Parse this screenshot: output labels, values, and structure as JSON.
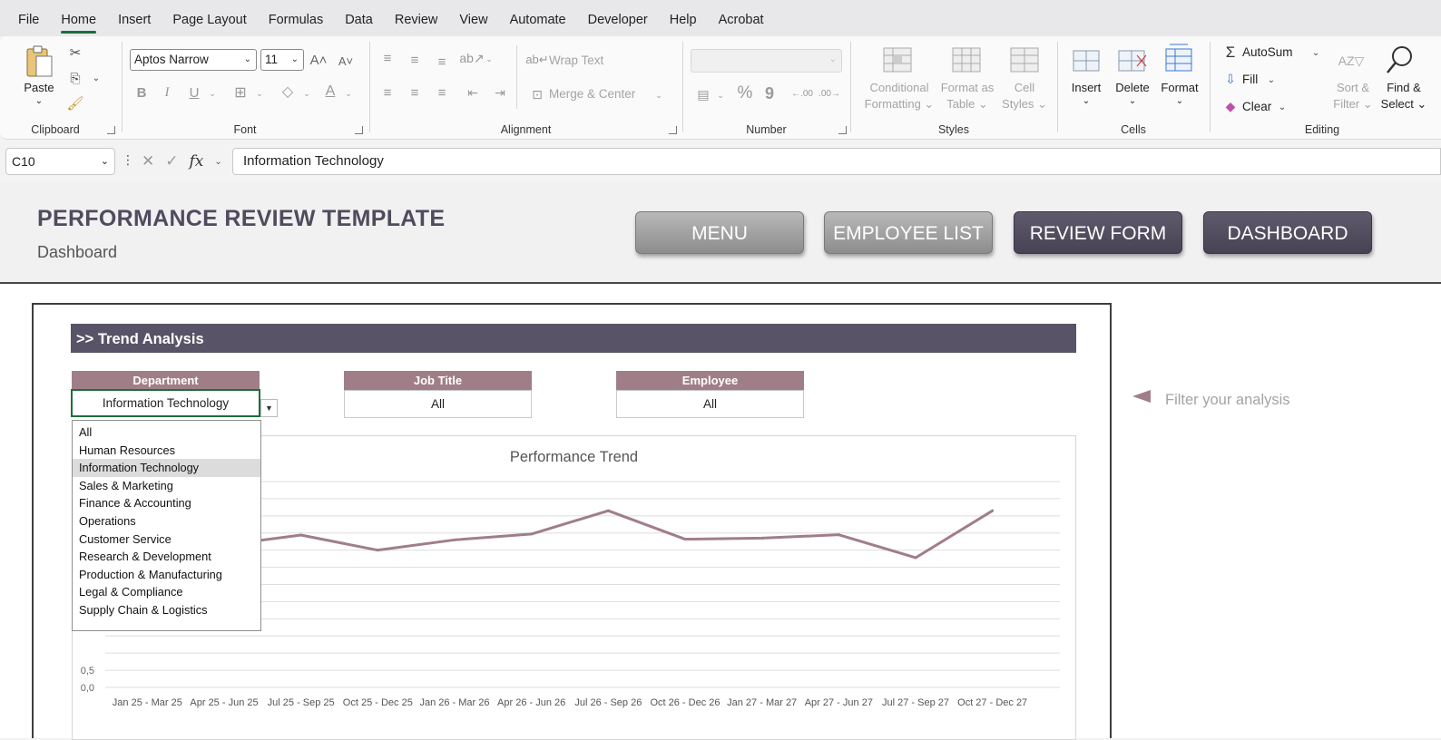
{
  "menu": [
    "File",
    "Home",
    "Insert",
    "Page Layout",
    "Formulas",
    "Data",
    "Review",
    "View",
    "Automate",
    "Developer",
    "Help",
    "Acrobat"
  ],
  "ribbon": {
    "clipboard": {
      "paste": "Paste",
      "label": "Clipboard"
    },
    "font": {
      "name": "Aptos Narrow",
      "size": "11",
      "label": "Font",
      "bold": "B",
      "italic": "I",
      "underline": "U"
    },
    "alignment": {
      "wrap": "Wrap Text",
      "merge": "Merge & Center",
      "label": "Alignment"
    },
    "number": {
      "label": "Number",
      "percent": "%",
      "comma": "9"
    },
    "styles": {
      "conditional_1": "Conditional",
      "conditional_2": "Formatting",
      "format_as_1": "Format as",
      "format_as_2": "Table",
      "cell_1": "Cell",
      "cell_2": "Styles",
      "label": "Styles"
    },
    "cells": {
      "insert": "Insert",
      "delete": "Delete",
      "format": "Format",
      "label": "Cells"
    },
    "editing": {
      "autosum": "AutoSum",
      "fill": "Fill",
      "clear": "Clear",
      "sort_1": "Sort &",
      "sort_2": "Filter",
      "find_1": "Find &",
      "find_2": "Select",
      "label": "Editing"
    }
  },
  "formula_bar": {
    "cell_ref": "C10",
    "fx": "fx",
    "content": "Information Technology"
  },
  "header": {
    "title": "PERFORMANCE REVIEW TEMPLATE",
    "subtitle": "Dashboard",
    "buttons": [
      "MENU",
      "EMPLOYEE LIST",
      "REVIEW FORM",
      "DASHBOARD"
    ]
  },
  "section": {
    "title": ">> Trend Analysis"
  },
  "filters": {
    "department": {
      "label": "Department",
      "value": "Information Technology"
    },
    "job_title": {
      "label": "Job Title",
      "value": "All"
    },
    "employee": {
      "label": "Employee",
      "value": "All"
    },
    "hint": "Filter your analysis"
  },
  "department_options": [
    "All",
    "Human Resources",
    "Information Technology",
    "Sales & Marketing",
    "Finance & Accounting",
    "Operations",
    "Customer Service",
    "Research & Development",
    "Production & Manufacturing",
    "Legal & Compliance",
    "Supply Chain & Logistics"
  ],
  "selected_option": "Information Technology",
  "colors": {
    "accent": "#585366",
    "filter_head": "#a07e88",
    "line": "#a07e88",
    "active_border": "#1d6e3f"
  },
  "chart_data": {
    "type": "line",
    "title": "Performance Trend",
    "categories": [
      "Jan 25 - Mar 25",
      "Apr 25 - Jun 25",
      "Jul 25 - Sep 25",
      "Oct 25 - Dec 25",
      "Jan 26 - Mar 26",
      "Apr 26 - Jun 26",
      "Jul 26 - Sep 26",
      "Oct 26 - Dec 26",
      "Jan 27 - Mar 27",
      "Apr 27 - Jun 27",
      "Jul 27 - Sep 27",
      "Oct 27 - Dec 27"
    ],
    "values": [
      4.0,
      4.15,
      4.44,
      4.0,
      4.3,
      4.47,
      5.15,
      4.32,
      4.35,
      4.45,
      3.78,
      5.15
    ],
    "y_tick_labels": [
      "0,0",
      "0,5"
    ],
    "ylim": [
      0,
      6
    ],
    "y_step": 0.5,
    "grid": true
  }
}
